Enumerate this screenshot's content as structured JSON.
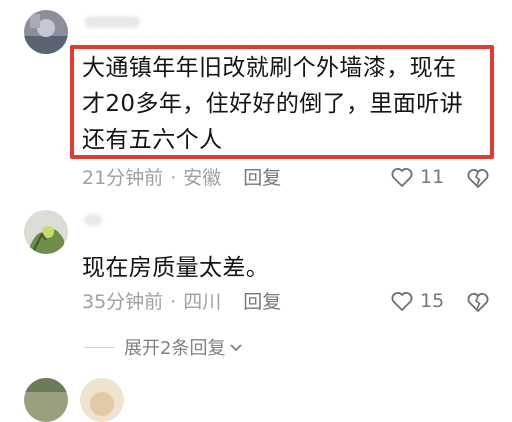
{
  "comments": [
    {
      "text": "大通镇年年旧改就刷个外墙漆，现在才20多年，住好好的倒了，里面听讲还有五六个人",
      "text_lines": [
        "大通镇年年旧改就刷个外墙漆，现在",
        "才20多年，住好好的倒了，里面听讲",
        "还有五六个人"
      ],
      "time": "21分钟前",
      "location": "安徽",
      "separator": "·",
      "reply_label": "回复",
      "likes": "11",
      "highlighted": true
    },
    {
      "text": "现在房质量太差。",
      "time": "35分钟前",
      "location": "四川",
      "separator": "·",
      "reply_label": "回复",
      "likes": "15",
      "expand_label": "展开2条回复"
    }
  ],
  "colors": {
    "highlight": "#e23a2e",
    "meta_text": "#a0a0a0"
  },
  "icons": {
    "like": "heart-outline-icon",
    "dislike": "broken-heart-outline-icon",
    "expand": "chevron-down-icon"
  }
}
